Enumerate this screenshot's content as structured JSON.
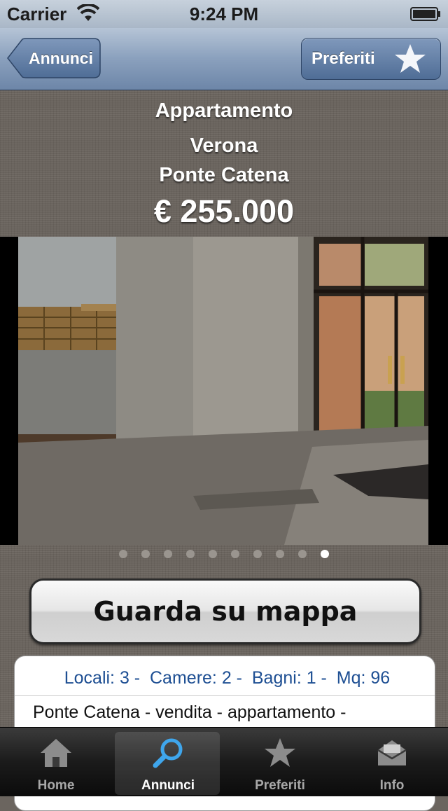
{
  "status_bar": {
    "carrier": "Carrier",
    "time": "9:24 PM"
  },
  "nav": {
    "back_label": "Annunci",
    "favorites_label": "Preferiti"
  },
  "listing": {
    "type": "Appartamento",
    "city": "Verona",
    "zone": "Ponte Catena",
    "price": "€ 255.000"
  },
  "gallery": {
    "page_count": 10,
    "current_page": 10
  },
  "map_button": {
    "label": "Guarda su mappa"
  },
  "details": {
    "summary": " Locali: 3 -  Camere: 2 -  Bagni: 1 -  Mq: 96",
    "description": "Ponte Catena - vendita - appartamento -"
  },
  "tabs": [
    {
      "label": "Home",
      "icon": "home-icon"
    },
    {
      "label": "Annunci",
      "icon": "search-icon",
      "selected": true
    },
    {
      "label": "Preferiti",
      "icon": "star-icon"
    },
    {
      "label": "Info",
      "icon": "mail-icon"
    }
  ],
  "colors": {
    "nav_blue": "#6d86a8",
    "summary_blue": "#1e4f93",
    "tab_bar": "#1b1b1b"
  }
}
